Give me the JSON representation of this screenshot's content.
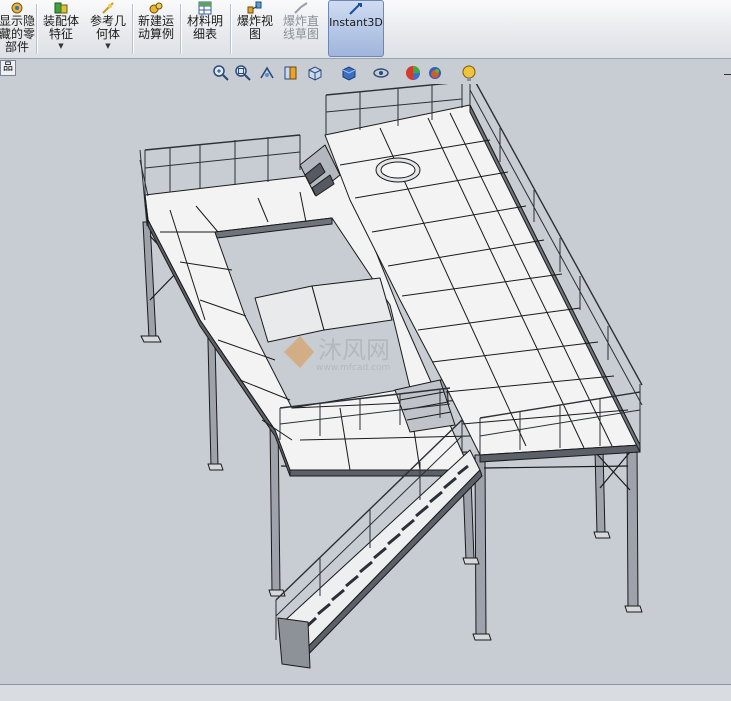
{
  "ribbon": {
    "buttons": [
      {
        "id": "show-hide",
        "label": "显示隐\n藏的零\n部件",
        "disabled": false,
        "dropdown": false
      },
      {
        "id": "assembly-features",
        "label": "装配体\n特征",
        "disabled": false,
        "dropdown": true
      },
      {
        "id": "ref-geometry",
        "label": "参考几\n何体",
        "disabled": false,
        "dropdown": true
      },
      {
        "id": "new-motion",
        "label": "新建运\n动算例",
        "disabled": false,
        "dropdown": false
      },
      {
        "id": "bom",
        "label": "材料明\n细表",
        "disabled": false,
        "dropdown": false
      },
      {
        "id": "exploded-view",
        "label": "爆炸视\n图",
        "disabled": false,
        "dropdown": false
      },
      {
        "id": "explode-sketch",
        "label": "爆炸直\n线草图",
        "disabled": true,
        "dropdown": false
      },
      {
        "id": "instant3d",
        "label": "Instant3D",
        "disabled": false,
        "dropdown": false
      }
    ]
  },
  "panel_tab": "品",
  "view_toolbar": {
    "icons": [
      "zoom-to-fit-icon",
      "zoom-to-area-icon",
      "previous-view-icon",
      "section-view-icon",
      "view-orientation-icon",
      "display-style-icon",
      "hide-show-items-icon",
      "edit-appearance-icon",
      "apply-scene-icon"
    ]
  },
  "watermark": {
    "text": "沐风网",
    "url": "www.mfcad.com"
  },
  "colors": {
    "viewport_bg": "#c8ccd3",
    "model_stroke": "#1a1a1a",
    "deck_fill": "#f4f4f4",
    "ribbon_accent": "#6f86b3"
  }
}
